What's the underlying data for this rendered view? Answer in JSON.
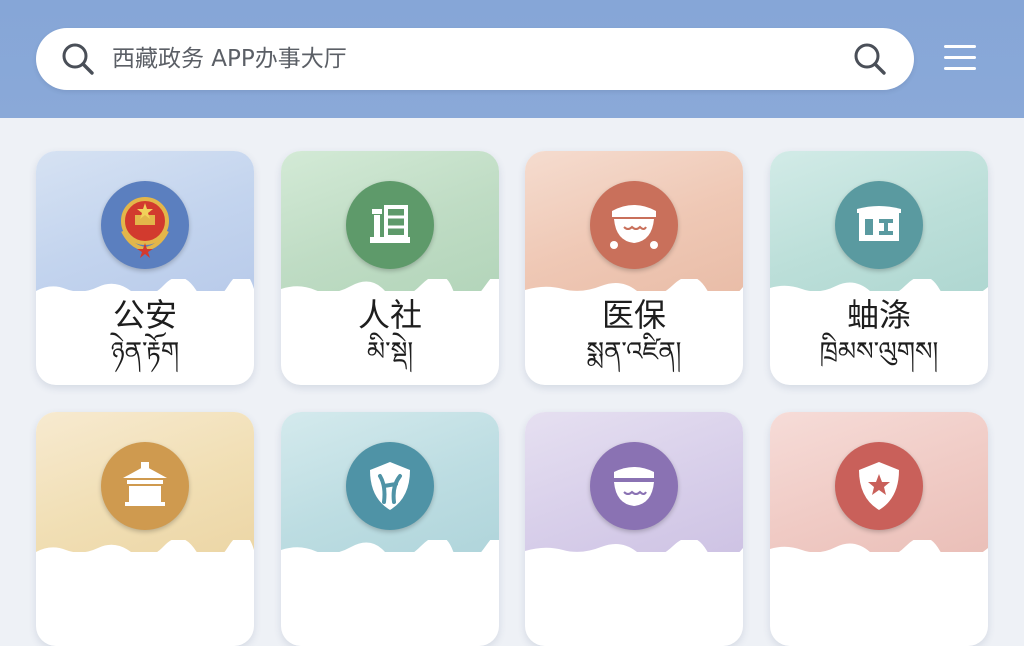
{
  "search": {
    "placeholder": "西藏政务 APP办事大厅",
    "left_icon": "search-icon",
    "right_icon": "search-icon"
  },
  "menu": {
    "icon": "hamburger-menu-icon"
  },
  "services": [
    {
      "label_zh": "公安",
      "label_bo": "ཉེན་རྟོག",
      "icon": "police-emblem-icon",
      "wash": "#c9d8ef",
      "badge": "#5b7fbf"
    },
    {
      "label_zh": "人社",
      "label_bo": "མི་སྡེ།",
      "icon": "building-icon",
      "wash": "#c4e0c9",
      "badge": "#5e9a6a"
    },
    {
      "label_zh": "医保",
      "label_bo": "སྨན་འཛིན།",
      "icon": "medical-bowl-icon",
      "wash": "#f1cfbe",
      "badge": "#c9705b"
    },
    {
      "label_zh": "蚰涤",
      "label_bo": "ཁྲིམས་ལུགས།",
      "icon": "document-icon",
      "wash": "#c0e0db",
      "badge": "#5a9aa0"
    },
    {
      "label_zh": "",
      "label_bo": "",
      "icon": "temple-icon",
      "wash": "#f3e2b6",
      "badge": "#cf9a4f"
    },
    {
      "label_zh": "",
      "label_bo": "",
      "icon": "shield-icon",
      "wash": "#c1dfe3",
      "badge": "#4f93a6"
    },
    {
      "label_zh": "",
      "label_bo": "",
      "icon": "bowl-icon",
      "wash": "#dcd3ea",
      "badge": "#8a72b3"
    },
    {
      "label_zh": "",
      "label_bo": "",
      "icon": "star-shield-icon",
      "wash": "#f2cdc8",
      "badge": "#c9605a"
    }
  ]
}
